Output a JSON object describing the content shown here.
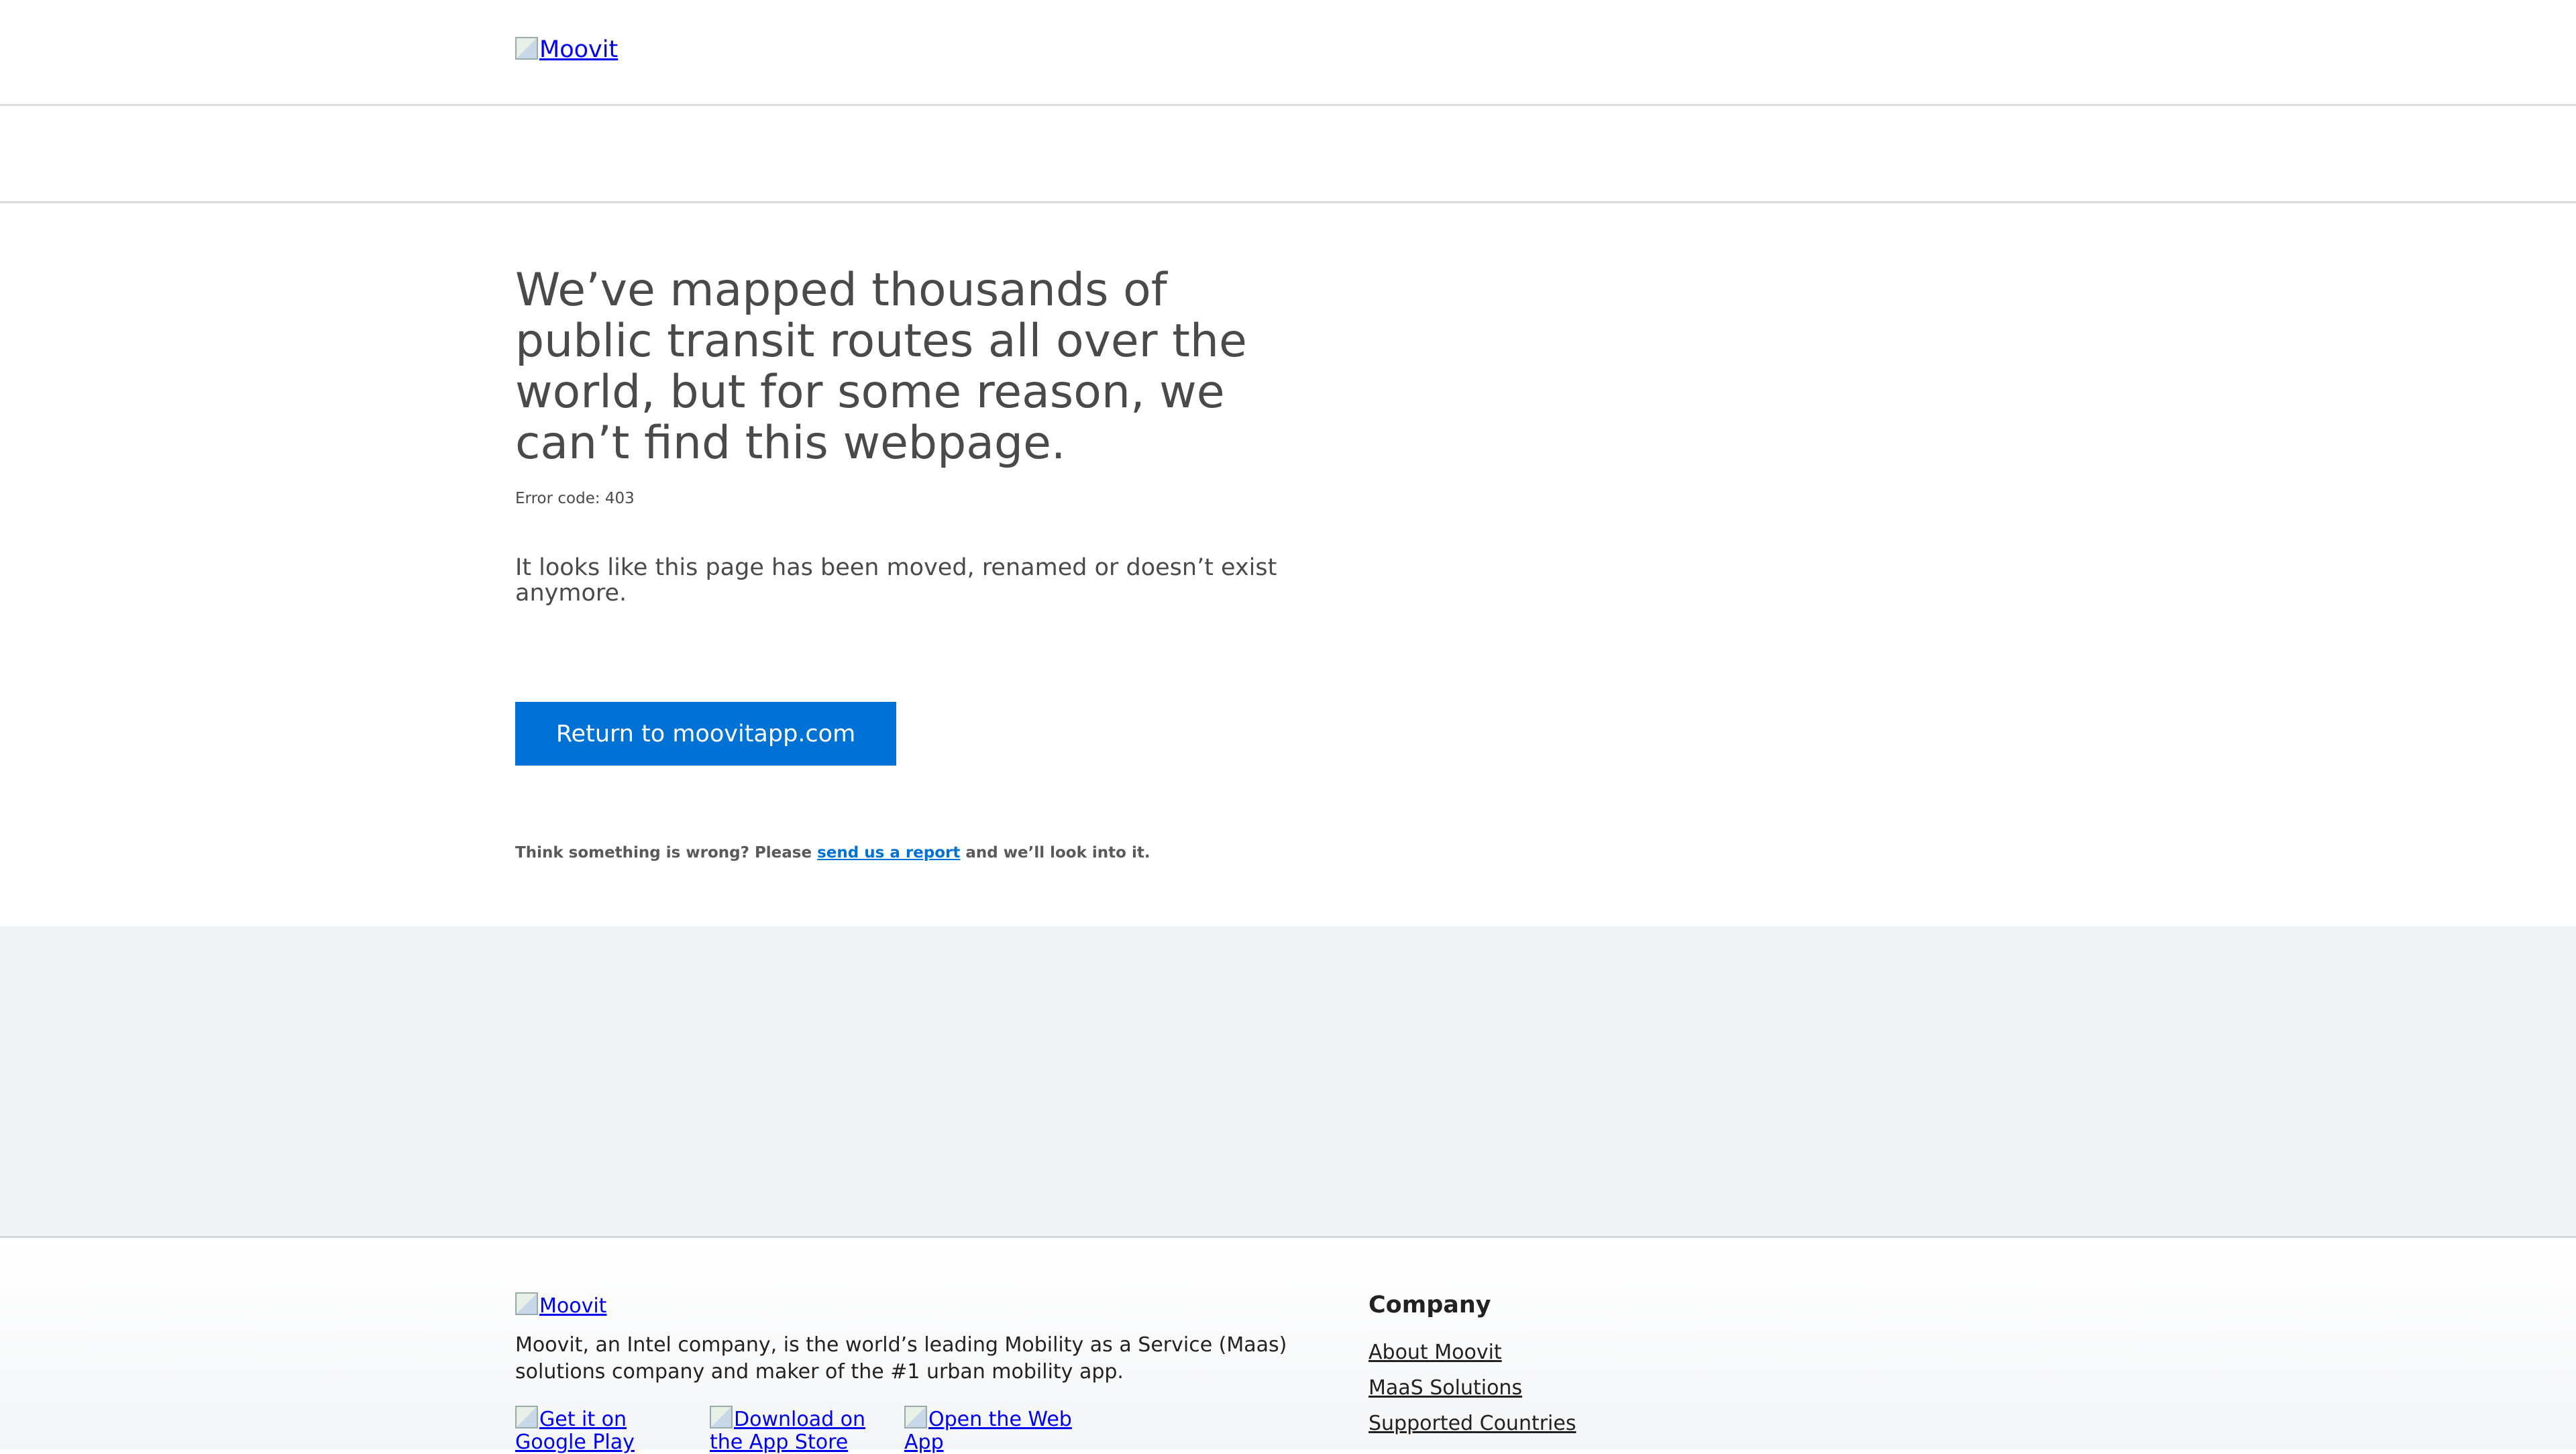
{
  "header": {
    "logo_alt": "Moovit"
  },
  "main": {
    "headline": "We’ve mapped thousands of public transit routes all over the world, but for some reason, we can’t find this webpage.",
    "error_code": "Error code: 403",
    "lead": "It looks like this page has been moved, renamed or doesn’t exist anymore.",
    "return_button": "Return to moovitapp.com",
    "report_prefix": "Think something is wrong? Please ",
    "report_link": "send us a report",
    "report_suffix": " and we’ll look into it."
  },
  "footer": {
    "logo_alt": "Moovit",
    "description": "Moovit, an Intel company, is the world’s leading Mobility as a Service (Maas) solutions company and maker of the #1 urban mobility app.",
    "badges": [
      "Get it on Google Play",
      "Download on the App Store",
      "Open the Web App"
    ],
    "company_title": "Company",
    "company_links": [
      "About Moovit",
      "MaaS Solutions",
      "Supported Countries"
    ]
  },
  "colors": {
    "primary_button": "#0072d6",
    "band": "#f1f4f7",
    "text": "#4a4a4a"
  }
}
